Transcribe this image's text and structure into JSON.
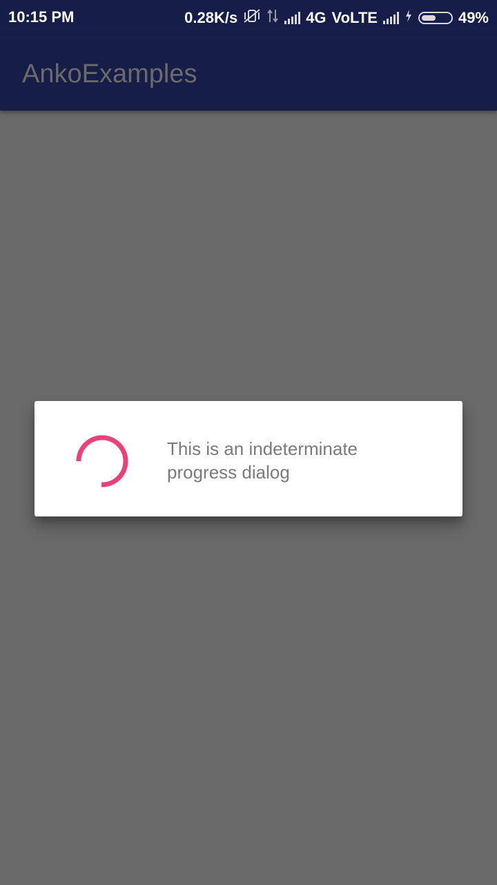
{
  "status_bar": {
    "time": "10:15 PM",
    "network_speed": "0.28K/s",
    "network_type": "4G",
    "volte": "VoLTE",
    "battery_percent": "49%",
    "battery_level": 0.49,
    "icons": [
      "vibrate-off-icon",
      "data-transfer-icon",
      "signal-icon",
      "signal-icon",
      "charging-icon",
      "battery-icon"
    ]
  },
  "app_bar": {
    "title": "AnkoExamples"
  },
  "dialog": {
    "message": "This is an indeterminate progress dialog",
    "spinner_color": "#ec407a"
  },
  "colors": {
    "primary_dark": "#161d49",
    "scrim": "#6a6a6a",
    "accent": "#ec407a"
  }
}
